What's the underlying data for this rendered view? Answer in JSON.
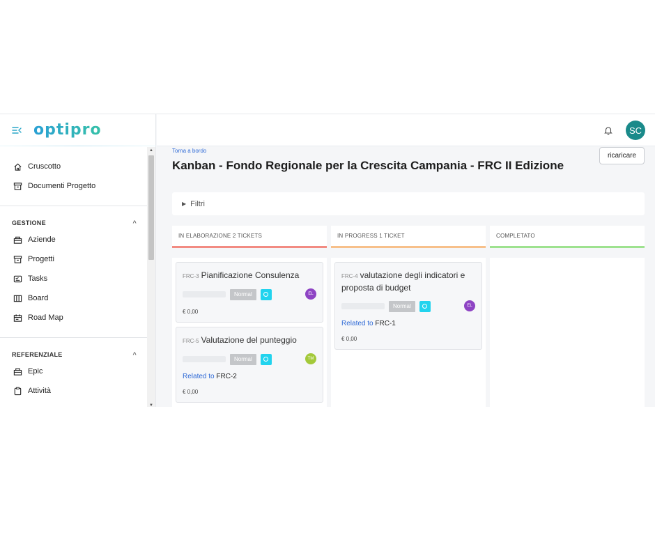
{
  "sidebar": {
    "logo": "optipro",
    "top_items": [
      {
        "label": "Cruscotto",
        "icon": "home-icon"
      },
      {
        "label": "Documenti Progetto",
        "icon": "archive-icon"
      }
    ],
    "sections": [
      {
        "title": "GESTIONE",
        "items": [
          {
            "label": "Aziende",
            "icon": "briefcase-icon"
          },
          {
            "label": "Progetti",
            "icon": "archive-icon"
          },
          {
            "label": "Tasks",
            "icon": "tasks-icon"
          },
          {
            "label": "Board",
            "icon": "columns-icon"
          },
          {
            "label": "Road Map",
            "icon": "calendar-icon"
          }
        ]
      },
      {
        "title": "REFERENZIALE",
        "items": [
          {
            "label": "Epic",
            "icon": "briefcase-icon"
          },
          {
            "label": "Attività",
            "icon": "clipboard-icon"
          }
        ]
      }
    ]
  },
  "topbar": {
    "avatar_initials": "SC",
    "avatar_color": "#1a8a8a"
  },
  "main": {
    "back_link": "Torna a bordo",
    "title": "Kanban - Fondo Regionale per la Crescita Campania - FRC II Edizione",
    "reload_label": "ricaricare",
    "filter_label": "Filtri"
  },
  "columns": [
    {
      "header": "IN ELABORAZIONE 2 TICKETS",
      "accent": "#f28b82",
      "cards": [
        {
          "key": "FRC-3",
          "title": "Pianificazione Consulenza",
          "priority": "Normal",
          "assignee": "EL",
          "assignee_color": "#8e44c4",
          "related_label": "",
          "related_key": "",
          "amount": "€ 0,00"
        },
        {
          "key": "FRC-5",
          "title": "Valutazione del punteggio",
          "priority": "Normal",
          "assignee": "TM",
          "assignee_color": "#a3c93a",
          "related_label": "Related to",
          "related_key": "FRC-2",
          "amount": "€ 0,00"
        }
      ]
    },
    {
      "header": "IN PROGRESS 1 TICKET",
      "accent": "#f7c08a",
      "cards": [
        {
          "key": "FRC-4",
          "title": "valutazione degli indicatori e proposta di budget",
          "priority": "Normal",
          "assignee": "EL",
          "assignee_color": "#8e44c4",
          "related_label": "Related to",
          "related_key": "FRC-1",
          "amount": "€ 0,00"
        }
      ]
    },
    {
      "header": "COMPLETATO",
      "accent": "#9ee28f",
      "cards": []
    }
  ]
}
